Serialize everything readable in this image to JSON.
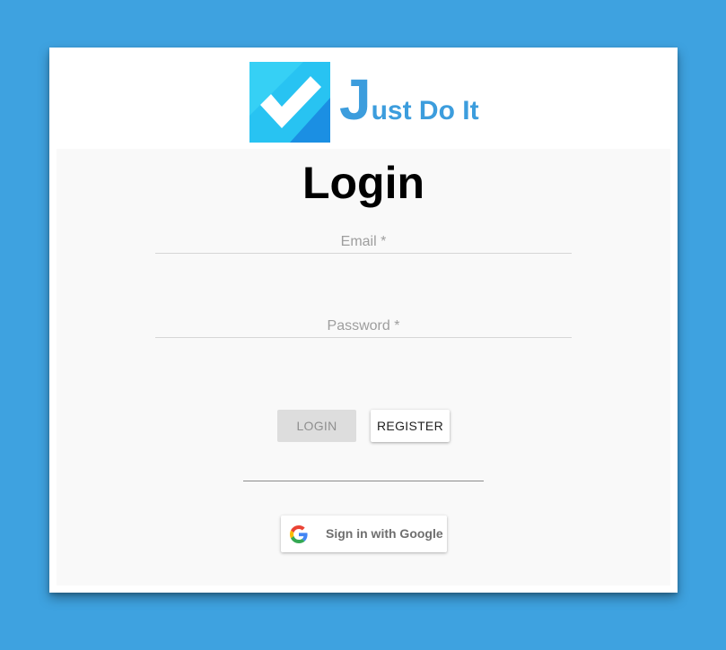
{
  "brand": {
    "logo_icon": "checkmark-icon",
    "name_first_letter": "J",
    "name_rest": "ust Do It",
    "color": "#3c9ddd"
  },
  "login_form": {
    "title": "Login",
    "email": {
      "label": "Email *",
      "value": ""
    },
    "password": {
      "label": "Password *",
      "value": ""
    },
    "login_button": "LOGIN",
    "register_button": "REGISTER",
    "google_button": "Sign in with Google",
    "google_icon": "google-g-icon"
  },
  "colors": {
    "background": "#3ea2e0",
    "card": "#ffffff",
    "panel": "#f9f9f9",
    "login_disabled": "#dddddd"
  }
}
